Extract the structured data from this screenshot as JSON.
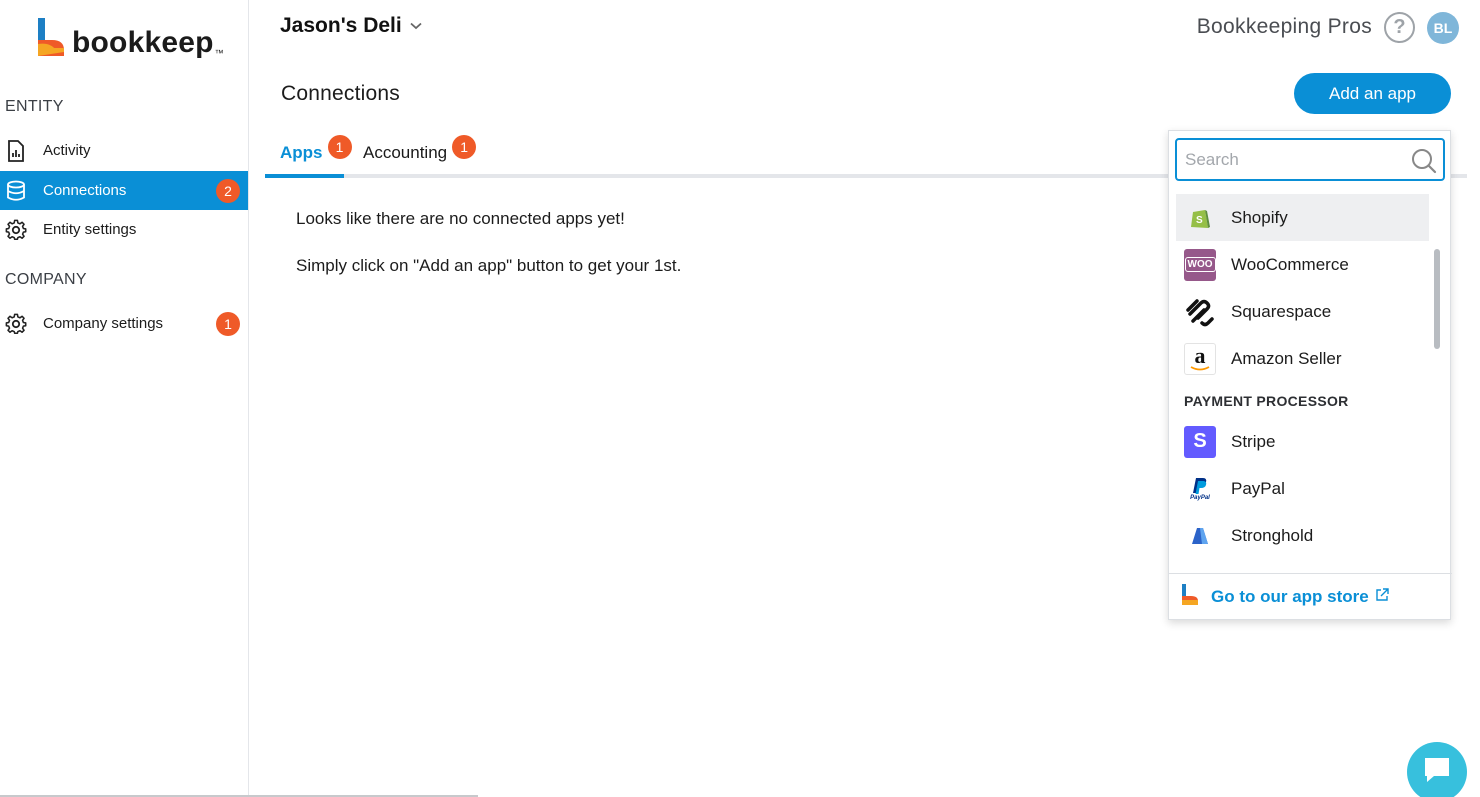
{
  "brand": {
    "logo_text": "bookkeep",
    "logo_tm": "™"
  },
  "sidebar": {
    "entity_section": "ENTITY",
    "company_section": "COMPANY",
    "items": [
      {
        "label": "Activity",
        "icon": "activity-report-icon",
        "active": false
      },
      {
        "label": "Connections",
        "icon": "database-icon",
        "active": true,
        "badge": "2"
      },
      {
        "label": "Entity settings",
        "icon": "gear-icon",
        "active": false
      },
      {
        "label": "Company settings",
        "icon": "gear-icon",
        "active": false,
        "badge": "1"
      }
    ]
  },
  "header": {
    "entity_name": "Jason's Deli",
    "org_name": "Bookkeeping Pros",
    "help_icon": "?",
    "avatar_initials": "BL"
  },
  "page": {
    "title": "Connections",
    "add_app_label": "Add an app",
    "tabs": [
      {
        "label": "Apps",
        "badge": "1",
        "active": true
      },
      {
        "label": "Accounting",
        "badge": "1",
        "active": false
      }
    ],
    "empty_line_1": "Looks like there are no connected apps yet!",
    "empty_line_2": "Simply click on \"Add an app\" button to get your 1st."
  },
  "dropdown": {
    "search_placeholder": "Search",
    "ecommerce": [
      {
        "name": "Shopify",
        "icon": "shopify-icon"
      },
      {
        "name": "WooCommerce",
        "icon": "woocommerce-icon",
        "icon_text": "WOO"
      },
      {
        "name": "Squarespace",
        "icon": "squarespace-icon"
      },
      {
        "name": "Amazon Seller",
        "icon": "amazon-icon",
        "icon_text": "a"
      }
    ],
    "payment_group_label": "PAYMENT PROCESSOR",
    "payment": [
      {
        "name": "Stripe",
        "icon": "stripe-icon",
        "icon_text": "S"
      },
      {
        "name": "PayPal",
        "icon": "paypal-icon",
        "icon_text": "PayPal"
      },
      {
        "name": "Stronghold",
        "icon": "stronghold-icon"
      }
    ],
    "footer_link": "Go to our app store"
  },
  "colors": {
    "primary": "#0a8fd6",
    "badge": "#ef5a28",
    "chat": "#37c0dd"
  }
}
